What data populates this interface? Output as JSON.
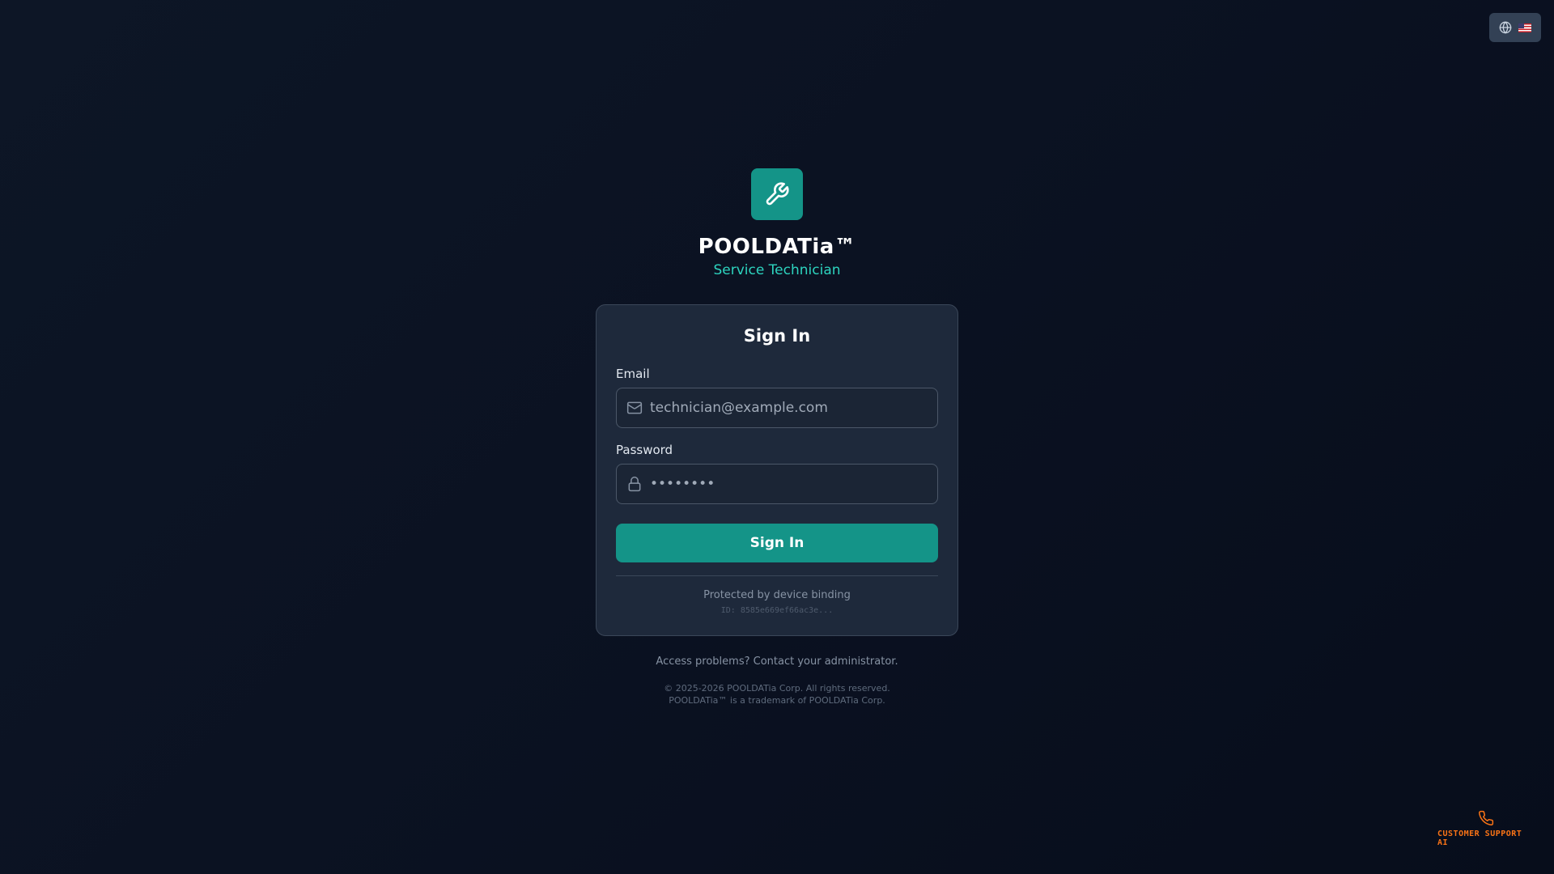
{
  "header": {
    "language_icon": "globe-icon",
    "flag_icon": "us-flag-icon"
  },
  "brand": {
    "logo_icon": "wrench-icon",
    "logo_color": "#149488",
    "name": "POOLDATia™",
    "subtitle": "Service Technician"
  },
  "signin": {
    "title": "Sign In",
    "email_label": "Email",
    "email_placeholder": "technician@example.com",
    "email_icon": "mail-icon",
    "password_label": "Password",
    "password_value": "••••••••",
    "password_icon": "lock-icon",
    "button_label": "Sign In",
    "protected_text": "Protected by device binding",
    "device_id": "ID: 8585e669ef66ac3e..."
  },
  "footer": {
    "access_text": "Access problems? Contact your administrator.",
    "copyright": "© 2025-2026 POOLDATia Corp. All rights reserved.",
    "trademark": "POOLDATia™ is a trademark of POOLDATia Corp."
  },
  "support": {
    "icon": "phone-icon",
    "label": "CUSTOMER SUPPORT AI",
    "color": "#f97316"
  },
  "colors": {
    "accent": "#149488",
    "accent_text": "#2dd4bf",
    "card_bg": "#1e293b"
  }
}
